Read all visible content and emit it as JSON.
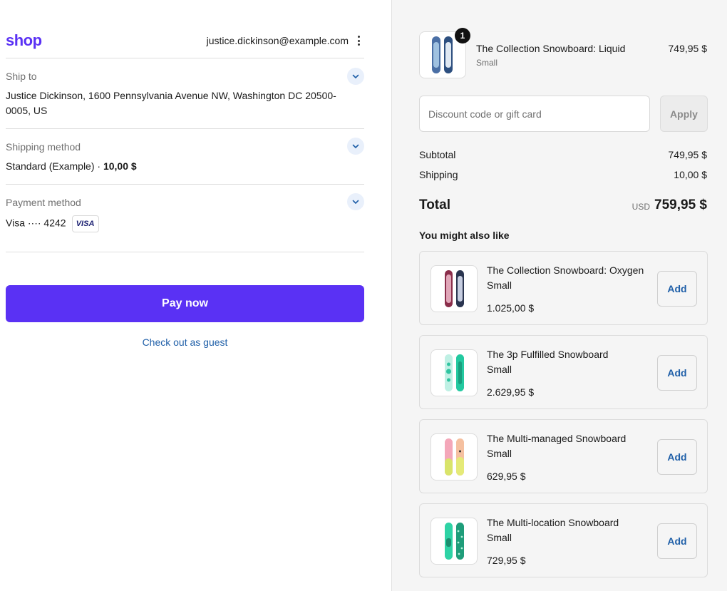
{
  "header": {
    "logo": "shop",
    "email": "justice.dickinson@example.com"
  },
  "ship_to": {
    "label": "Ship to",
    "line1": "Justice Dickinson, 1600 Pennsylvania Avenue NW, Washington DC 20500-",
    "line2": "0005, US"
  },
  "shipping_method": {
    "label": "Shipping method",
    "name": "Standard (Example) · ",
    "price": "10,00 $"
  },
  "payment_method": {
    "label": "Payment method",
    "card": "Visa ···· 4242",
    "brand": "VISA"
  },
  "pay_button": "Pay now",
  "guest_link": "Check out as guest",
  "cart_item": {
    "quantity": "1",
    "name": "The Collection Snowboard: Liquid",
    "variant": "Small",
    "price": "749,95 $"
  },
  "discount": {
    "placeholder": "Discount code or gift card",
    "apply": "Apply"
  },
  "summary": {
    "subtotal_label": "Subtotal",
    "subtotal_value": "749,95 $",
    "shipping_label": "Shipping",
    "shipping_value": "10,00 $",
    "total_label": "Total",
    "currency": "USD",
    "total_value": "759,95 $"
  },
  "recommendations": {
    "title": "You might also like",
    "add_label": "Add",
    "items": [
      {
        "name": "The Collection Snowboard: Oxygen",
        "variant": "Small",
        "price": "1.025,00 $"
      },
      {
        "name": "The 3p Fulfilled Snowboard",
        "variant": "Small",
        "price": "2.629,95 $"
      },
      {
        "name": "The Multi-managed Snowboard",
        "variant": "Small",
        "price": "629,95 $"
      },
      {
        "name": "The Multi-location Snowboard",
        "variant": "Small",
        "price": "729,95 $"
      }
    ]
  },
  "colors": {
    "brand": "#5a31f4",
    "link": "#1f5fa8",
    "sidebar_bg": "#f5f5f5"
  }
}
